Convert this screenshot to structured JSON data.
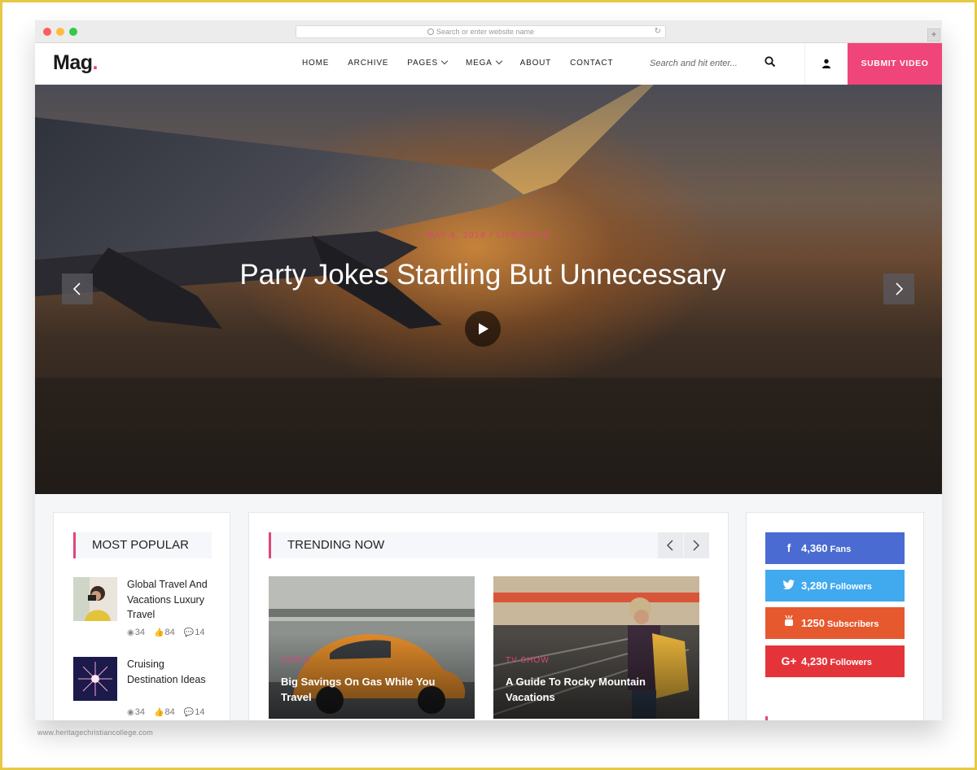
{
  "browser": {
    "url_placeholder": "Search or enter website name",
    "new_tab_label": "+"
  },
  "header": {
    "logo_text": "Mag",
    "logo_dot": ".",
    "nav": [
      {
        "label": "HOME"
      },
      {
        "label": "ARCHIVE"
      },
      {
        "label": "PAGES"
      },
      {
        "label": "MEGA"
      },
      {
        "label": "ABOUT"
      },
      {
        "label": "CONTACT"
      }
    ],
    "search_placeholder": "Search and hit enter...",
    "submit_label": "SUBMIT VIDEO"
  },
  "hero": {
    "meta": "MAY 8, 2018 / LIFESTYLE",
    "title": "Party Jokes Startling But Unnecessary"
  },
  "popular": {
    "title": "MOST POPULAR",
    "posts": [
      {
        "title": "Global Travel And Vacations Luxury Travel",
        "views": "34",
        "likes": "84",
        "comments": "14"
      },
      {
        "title": "Cruising Destination Ideas",
        "views": "34",
        "likes": "84",
        "comments": "14"
      }
    ]
  },
  "trending": {
    "title": "TRENDING NOW",
    "items": [
      {
        "category": "VIDEO",
        "title": "Big Savings On Gas While You Travel"
      },
      {
        "category": "TV SHOW",
        "title": "A Guide To Rocky Mountain Vacations"
      }
    ]
  },
  "social": {
    "buttons": [
      {
        "icon": "f",
        "count": "4,360",
        "unit": "Fans"
      },
      {
        "icon": "t",
        "count": "3,280",
        "unit": "Followers"
      },
      {
        "icon": "yt",
        "count": "1250",
        "unit": "Subscribers"
      },
      {
        "icon": "G+",
        "count": "4,230",
        "unit": "Followers"
      }
    ]
  },
  "footer": {
    "watermark": "www.heritagechristiancollege.com"
  },
  "colors": {
    "accent": "#f0457a",
    "facebook": "#4a6bd1",
    "twitter": "#41a9ee",
    "youtube": "#e6592f",
    "googleplus": "#e4343a"
  }
}
